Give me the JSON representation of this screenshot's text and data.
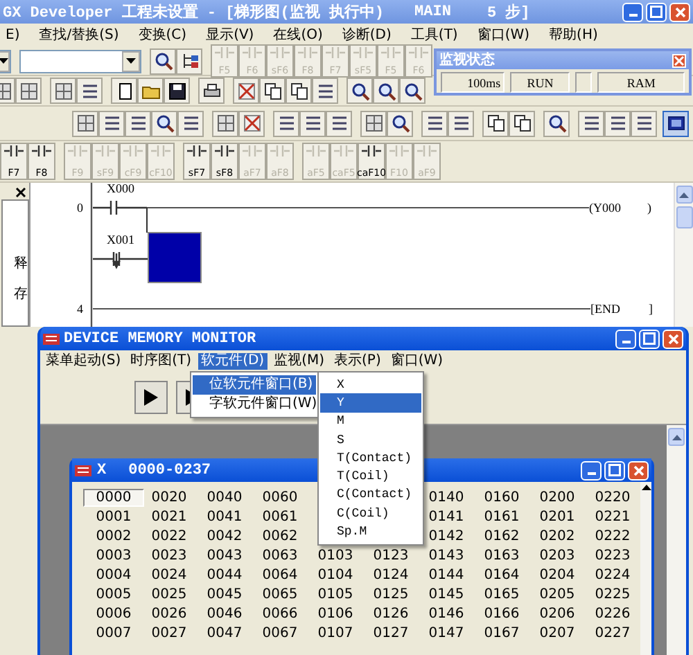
{
  "window": {
    "title": "GX Developer 工程未设置 - [梯形图(监视 执行中)",
    "program": "MAIN",
    "steps": "5 步]"
  },
  "menu": [
    "E)",
    "查找/替换(S)",
    "变换(C)",
    "显示(V)",
    "在线(O)",
    "诊断(D)",
    "工具(T)",
    "窗口(W)",
    "帮助(H)"
  ],
  "toolbar": {
    "monitor_button_pressed": true,
    "top_keys": [
      {
        "label": "F5",
        "disabled": true
      },
      {
        "label": "F6",
        "disabled": true
      },
      {
        "label": "sF6",
        "disabled": true
      },
      {
        "label": "F8",
        "disabled": true
      },
      {
        "label": "F7",
        "disabled": true
      },
      {
        "label": "sF5",
        "disabled": true
      },
      {
        "label": "F5",
        "disabled": true
      },
      {
        "label": "F6",
        "disabled": true
      }
    ],
    "bottom_keys": [
      {
        "label": "F7",
        "disabled": false
      },
      {
        "label": "F8",
        "disabled": false
      },
      {
        "label": "F9",
        "disabled": true
      },
      {
        "label": "sF9",
        "disabled": true
      },
      {
        "label": "cF9",
        "disabled": true
      },
      {
        "label": "cF10",
        "disabled": true
      },
      {
        "label": "sF7",
        "disabled": false
      },
      {
        "label": "sF8",
        "disabled": false
      },
      {
        "label": "aF7",
        "disabled": true
      },
      {
        "label": "aF8",
        "disabled": true
      },
      {
        "label": "aF5",
        "disabled": true
      },
      {
        "label": "caF5",
        "disabled": true
      },
      {
        "label": "caF10",
        "disabled": false
      },
      {
        "label": "F10",
        "disabled": true
      },
      {
        "label": "aF9",
        "disabled": true
      }
    ]
  },
  "monitor_status": {
    "title": "监视状态",
    "scan_time": "100ms",
    "cpu_state": "RUN",
    "memory": "RAM"
  },
  "left_panel": {
    "items": [
      "释",
      "存"
    ]
  },
  "ladder": {
    "step_numbers": [
      "0",
      "4"
    ],
    "contacts": [
      "X000",
      "X001"
    ],
    "coil": "(Y000",
    "coil_end": ")",
    "end": "[END",
    "end_close": "]"
  },
  "device_monitor": {
    "title": "DEVICE MEMORY MONITOR",
    "menu": [
      {
        "label": "菜单起动(S)",
        "selected": false
      },
      {
        "label": "时序图(T)",
        "selected": false
      },
      {
        "label": "软元件(D)",
        "selected": true
      },
      {
        "label": "监视(M)",
        "selected": false
      },
      {
        "label": "表示(P)",
        "selected": false
      },
      {
        "label": "窗口(W)",
        "selected": false
      }
    ],
    "submenu": [
      {
        "label": "位软元件窗口(B)",
        "selected": true
      },
      {
        "label": "字软元件窗口(W)",
        "selected": false
      }
    ],
    "device_menu": [
      {
        "label": "X",
        "selected": false
      },
      {
        "label": "Y",
        "selected": true
      },
      {
        "label": "M",
        "selected": false
      },
      {
        "label": "S",
        "selected": false
      },
      {
        "label": "T(Contact)",
        "selected": false
      },
      {
        "label": "T(Coil)",
        "selected": false
      },
      {
        "label": "C(Contact)",
        "selected": false
      },
      {
        "label": "C(Coil)",
        "selected": false
      },
      {
        "label": "Sp.M",
        "selected": false
      }
    ],
    "device_window": {
      "title": "X",
      "range": "0000-0237",
      "rows": [
        [
          {
            "text": "0000",
            "selected": true
          },
          {
            "text": "0020",
            "selected": false
          },
          {
            "text": "0040",
            "selected": false
          },
          {
            "text": "0060",
            "selected": false
          },
          null,
          null,
          {
            "text": "0140",
            "selected": false
          },
          {
            "text": "0160",
            "selected": false
          },
          {
            "text": "0200",
            "selected": false
          },
          {
            "text": "0220",
            "selected": false
          }
        ],
        [
          {
            "text": "0001",
            "selected": false
          },
          {
            "text": "0021",
            "selected": false
          },
          {
            "text": "0041",
            "selected": false
          },
          {
            "text": "0061",
            "selected": false
          },
          null,
          null,
          {
            "text": "0141",
            "selected": false
          },
          {
            "text": "0161",
            "selected": false
          },
          {
            "text": "0201",
            "selected": false
          },
          {
            "text": "0221",
            "selected": false
          }
        ],
        [
          {
            "text": "0002",
            "selected": false
          },
          {
            "text": "0022",
            "selected": false
          },
          {
            "text": "0042",
            "selected": false
          },
          {
            "text": "0062",
            "selected": false
          },
          null,
          null,
          {
            "text": "0142",
            "selected": false
          },
          {
            "text": "0162",
            "selected": false
          },
          {
            "text": "0202",
            "selected": false
          },
          {
            "text": "0222",
            "selected": false
          }
        ],
        [
          {
            "text": "0003",
            "selected": false
          },
          {
            "text": "0023",
            "selected": false
          },
          {
            "text": "0043",
            "selected": false
          },
          {
            "text": "0063",
            "selected": false
          },
          {
            "text": "0103",
            "selected": false
          },
          {
            "text": "0123",
            "selected": false
          },
          {
            "text": "0143",
            "selected": false
          },
          {
            "text": "0163",
            "selected": false
          },
          {
            "text": "0203",
            "selected": false
          },
          {
            "text": "0223",
            "selected": false
          }
        ],
        [
          {
            "text": "0004",
            "selected": false
          },
          {
            "text": "0024",
            "selected": false
          },
          {
            "text": "0044",
            "selected": false
          },
          {
            "text": "0064",
            "selected": false
          },
          {
            "text": "0104",
            "selected": false
          },
          {
            "text": "0124",
            "selected": false
          },
          {
            "text": "0144",
            "selected": false
          },
          {
            "text": "0164",
            "selected": false
          },
          {
            "text": "0204",
            "selected": false
          },
          {
            "text": "0224",
            "selected": false
          }
        ],
        [
          {
            "text": "0005",
            "selected": false
          },
          {
            "text": "0025",
            "selected": false
          },
          {
            "text": "0045",
            "selected": false
          },
          {
            "text": "0065",
            "selected": false
          },
          {
            "text": "0105",
            "selected": false
          },
          {
            "text": "0125",
            "selected": false
          },
          {
            "text": "0145",
            "selected": false
          },
          {
            "text": "0165",
            "selected": false
          },
          {
            "text": "0205",
            "selected": false
          },
          {
            "text": "0225",
            "selected": false
          }
        ],
        [
          {
            "text": "0006",
            "selected": false
          },
          {
            "text": "0026",
            "selected": false
          },
          {
            "text": "0046",
            "selected": false
          },
          {
            "text": "0066",
            "selected": false
          },
          {
            "text": "0106",
            "selected": false
          },
          {
            "text": "0126",
            "selected": false
          },
          {
            "text": "0146",
            "selected": false
          },
          {
            "text": "0166",
            "selected": false
          },
          {
            "text": "0206",
            "selected": false
          },
          {
            "text": "0226",
            "selected": false
          }
        ],
        [
          {
            "text": "0007",
            "selected": false
          },
          {
            "text": "0027",
            "selected": false
          },
          {
            "text": "0047",
            "selected": false
          },
          {
            "text": "0067",
            "selected": false
          },
          {
            "text": "0107",
            "selected": false
          },
          {
            "text": "0127",
            "selected": false
          },
          {
            "text": "0147",
            "selected": false
          },
          {
            "text": "0167",
            "selected": false
          },
          {
            "text": "0207",
            "selected": false
          },
          {
            "text": "0227",
            "selected": false
          }
        ]
      ]
    }
  }
}
